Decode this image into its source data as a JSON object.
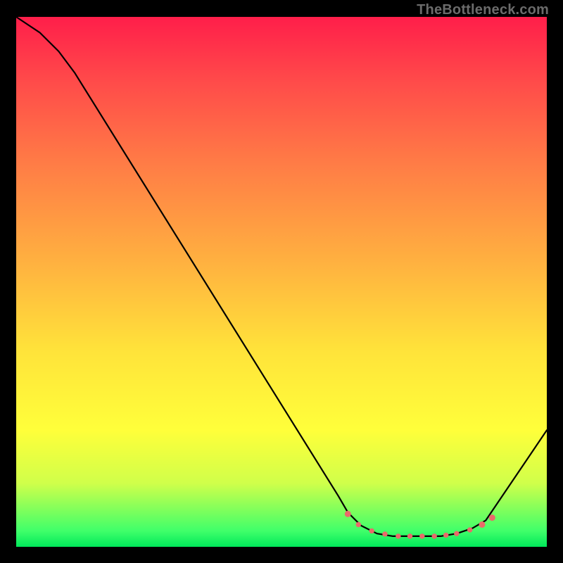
{
  "attribution": "TheBottleneck.com",
  "chart_data": {
    "type": "line",
    "title": "",
    "xlabel": "",
    "ylabel": "",
    "xlim": [
      0,
      100
    ],
    "ylim": [
      0,
      100
    ],
    "curve": [
      {
        "x": 0.0,
        "y": 100.0
      },
      {
        "x": 4.5,
        "y": 97.0
      },
      {
        "x": 8.0,
        "y": 93.5
      },
      {
        "x": 11.0,
        "y": 89.5
      },
      {
        "x": 60.7,
        "y": 9.6
      },
      {
        "x": 62.5,
        "y": 6.5
      },
      {
        "x": 65.0,
        "y": 4.0
      },
      {
        "x": 68.0,
        "y": 2.5
      },
      {
        "x": 71.0,
        "y": 2.0
      },
      {
        "x": 74.0,
        "y": 2.0
      },
      {
        "x": 77.0,
        "y": 2.0
      },
      {
        "x": 80.0,
        "y": 2.0
      },
      {
        "x": 83.0,
        "y": 2.5
      },
      {
        "x": 86.0,
        "y": 3.5
      },
      {
        "x": 88.5,
        "y": 5.0
      },
      {
        "x": 100.0,
        "y": 22.0
      }
    ],
    "markers_x": [
      62.5,
      64.5,
      67.0,
      69.5,
      72.0,
      74.2,
      76.5,
      78.8,
      81.0,
      83.0,
      85.5,
      87.8,
      89.7
    ],
    "markers_y": [
      6.2,
      4.2,
      3.0,
      2.4,
      2.0,
      2.0,
      2.0,
      2.0,
      2.2,
      2.5,
      3.2,
      4.2,
      5.5
    ],
    "marker_radii": [
      4.0,
      3.2,
      3.2,
      3.2,
      3.2,
      3.2,
      3.2,
      3.2,
      3.2,
      3.2,
      3.2,
      4.0,
      4.0
    ]
  }
}
